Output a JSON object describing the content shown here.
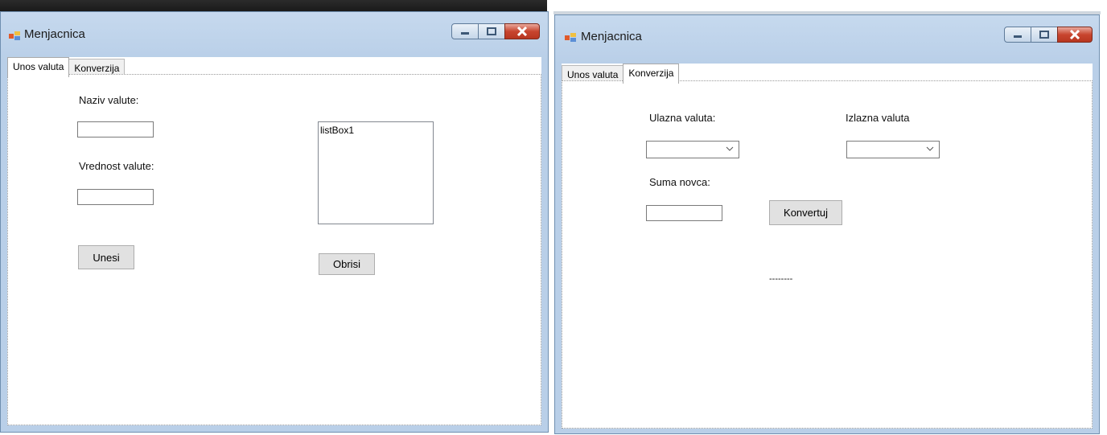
{
  "windows": [
    {
      "title": "Menjacnica",
      "tabs": [
        {
          "label": "Unos valuta",
          "active": true
        },
        {
          "label": "Konverzija",
          "active": false
        }
      ],
      "naziv_label": "Naziv valute:",
      "vrednost_label": "Vrednost valute:",
      "naziv_value": "",
      "vrednost_value": "",
      "listbox_text": "listBox1",
      "unesi_label": "Unesi",
      "obrisi_label": "Obrisi"
    },
    {
      "title": "Menjacnica",
      "tabs": [
        {
          "label": "Unos valuta",
          "active": false
        },
        {
          "label": "Konverzija",
          "active": true
        }
      ],
      "ulazna_label": "Ulazna valuta:",
      "izlazna_label": "Izlazna valuta",
      "suma_label": "Suma novca:",
      "suma_value": "",
      "ulazna_selected": "",
      "izlazna_selected": "",
      "konvertuj_label": "Konvertuj",
      "result_text": "--------"
    }
  ],
  "icons": {
    "app": "app-window-icon",
    "minimize": "minimize-icon",
    "maximize": "maximize-icon",
    "close": "close-icon",
    "dropdown": "chevron-down-icon"
  },
  "colors": {
    "titlebar": "#b9cfe8",
    "close_button": "#c8452f",
    "button_face": "#e1e1e1"
  }
}
